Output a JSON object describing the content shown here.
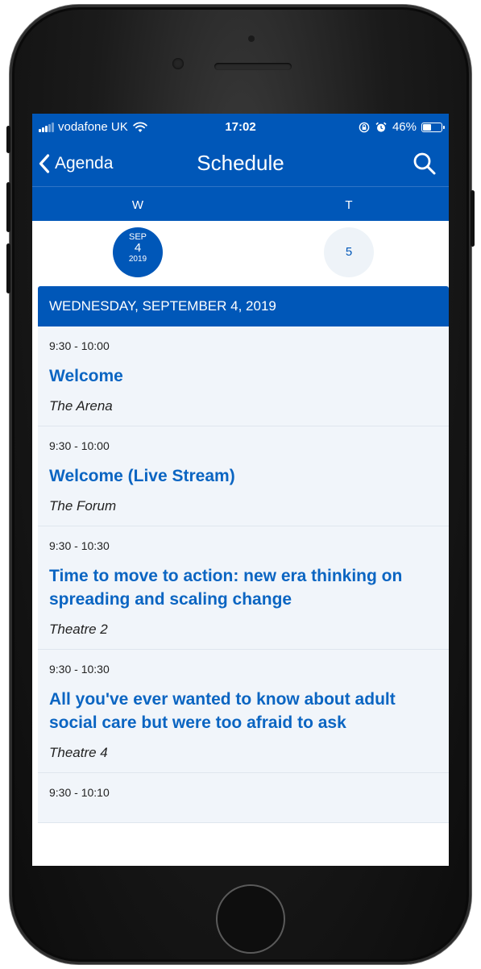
{
  "status_bar": {
    "carrier": "vodafone UK",
    "time": "17:02",
    "battery": "46%",
    "battery_level": 0.46
  },
  "nav": {
    "back_label": "Agenda",
    "title": "Schedule"
  },
  "day_strip": {
    "letters": [
      "W",
      "T"
    ],
    "selected": {
      "month": "SEP",
      "day": "4",
      "year": "2019"
    },
    "other_day": "5"
  },
  "section_header": "WEDNESDAY, SEPTEMBER 4, 2019",
  "sessions": [
    {
      "time": "9:30 - 10:00",
      "title": "Welcome",
      "location": "The Arena"
    },
    {
      "time": "9:30 - 10:00",
      "title": "Welcome (Live Stream)",
      "location": "The Forum"
    },
    {
      "time": "9:30 - 10:30",
      "title": "Time to move to action: new era thinking on spreading and scaling change",
      "location": "Theatre 2"
    },
    {
      "time": "9:30 - 10:30",
      "title": "All you've ever wanted to know about adult social care but were too afraid to ask",
      "location": "Theatre 4"
    },
    {
      "time": "9:30 - 10:10",
      "title": "",
      "location": ""
    }
  ],
  "colors": {
    "brand_blue": "#0057b8",
    "title_blue": "#0b65c2",
    "row_bg": "#f1f5fa"
  },
  "icons": {
    "back": "chevron-left-icon",
    "search": "search-icon",
    "wifi": "wifi-icon",
    "signal": "cellular-signal-icon",
    "alarm": "alarm-clock-icon",
    "rotation_lock": "rotation-lock-icon",
    "battery": "battery-icon"
  }
}
